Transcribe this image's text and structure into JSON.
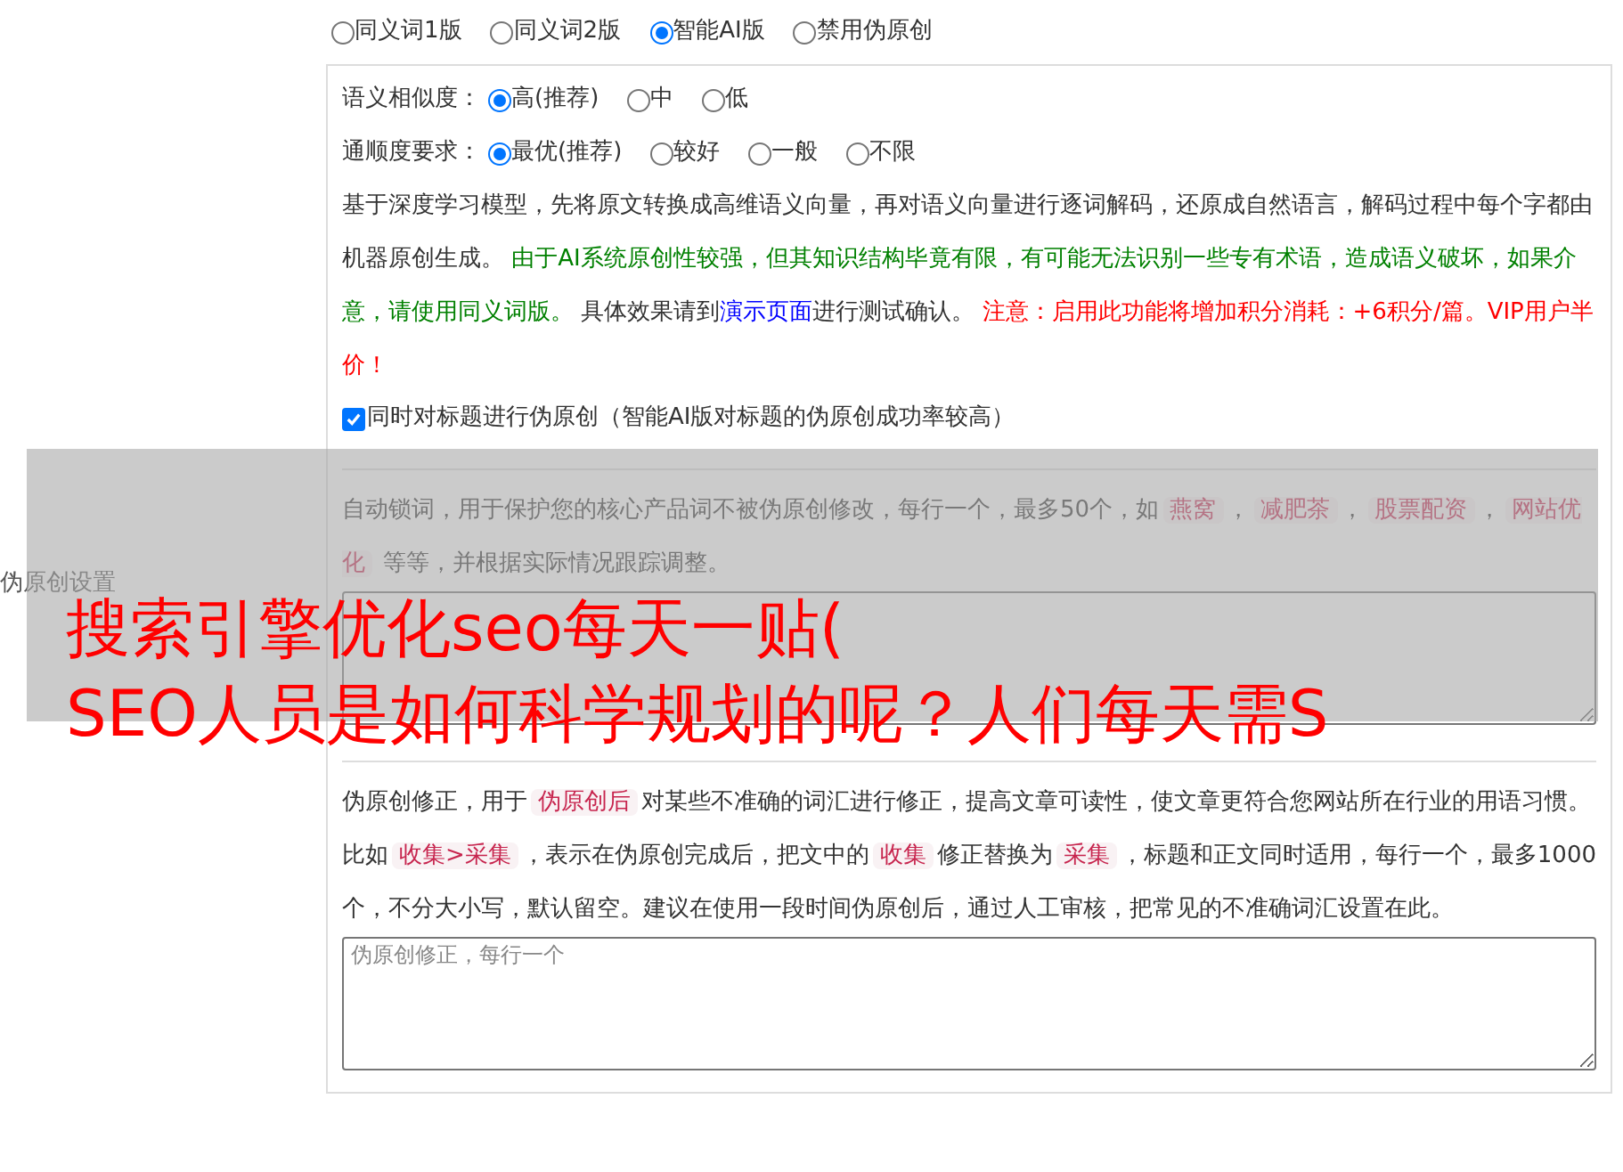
{
  "side_label": "伪原创设置",
  "modes": [
    {
      "label": "同义词1版",
      "selected": false
    },
    {
      "label": "同义词2版",
      "selected": false
    },
    {
      "label": "智能AI版",
      "selected": true
    },
    {
      "label": "禁用伪原创",
      "selected": false
    }
  ],
  "similarity": {
    "label": "语义相似度：",
    "options": [
      {
        "label": "高(推荐)",
        "selected": true
      },
      {
        "label": "中",
        "selected": false
      },
      {
        "label": "低",
        "selected": false
      }
    ]
  },
  "fluency": {
    "label": "通顺度要求：",
    "options": [
      {
        "label": "最优(推荐)",
        "selected": true
      },
      {
        "label": "较好",
        "selected": false
      },
      {
        "label": "一般",
        "selected": false
      },
      {
        "label": "不限",
        "selected": false
      }
    ]
  },
  "ai_description": [
    {
      "kind": "plain",
      "text": "基于深度学习模型，先将原文转换成高维语义向量，再对语义向量进行逐词解码，还原成自然语言，解码过程中每个字都由机器原创生成。 "
    },
    {
      "kind": "green",
      "text": "由于AI系统原创性较强，但其知识结构毕竟有限，有可能无法识别一些专有术语，造成语义破坏，如果介意，请使用同义词版。"
    },
    {
      "kind": "plain",
      "text": " 具体效果请到"
    },
    {
      "kind": "link",
      "text": "演示页面"
    },
    {
      "kind": "plain",
      "text": "进行测试确认。 "
    },
    {
      "kind": "red",
      "text": "注意：启用此功能将增加积分消耗：+6积分/篇。VIP用户半价！"
    }
  ],
  "title_option": {
    "label": "同时对标题进行伪原创（智能AI版对标题的伪原创成功率较高）",
    "checked": true
  },
  "lock_words": {
    "description": [
      {
        "kind": "plain",
        "text": "自动锁词，用于保护您的核心产品词不被伪原创修改，每行一个，最多50个，如"
      },
      {
        "kind": "tag",
        "text": "燕窝"
      },
      {
        "kind": "plain",
        "text": "，"
      },
      {
        "kind": "tag",
        "text": "减肥茶"
      },
      {
        "kind": "plain",
        "text": "，"
      },
      {
        "kind": "tag",
        "text": "股票配资"
      },
      {
        "kind": "plain",
        "text": "，"
      },
      {
        "kind": "tag",
        "text": "网站优化"
      },
      {
        "kind": "plain",
        "text": " 等等，并根据实际情况跟踪调整。"
      }
    ]
  },
  "corrections": {
    "description": [
      {
        "kind": "plain",
        "text": "伪原创修正，用于"
      },
      {
        "kind": "tag",
        "text": "伪原创后"
      },
      {
        "kind": "plain",
        "text": "对某些不准确的词汇进行修正，提高文章可读性，使文章更符合您网站所在行业的用语习惯。比如"
      },
      {
        "kind": "tag",
        "text": "收集>采集"
      },
      {
        "kind": "plain",
        "text": "，表示在伪原创完成后，把文中的"
      },
      {
        "kind": "tag",
        "text": "收集"
      },
      {
        "kind": "plain",
        "text": "修正替换为"
      },
      {
        "kind": "tag",
        "text": "采集"
      },
      {
        "kind": "plain",
        "text": "，标题和正文同时适用，每行一个，最多1000个，不分大小写，默认留空。建议在使用一段时间伪原创后，通过人工审核，把常见的不准确词汇设置在此。"
      }
    ],
    "placeholder": "伪原创修正，每行一个"
  },
  "overlay_title": [
    "搜索引擎优化seo每天一贴(",
    "SEO人员是如何科学规划的呢？人们每天需S"
  ]
}
